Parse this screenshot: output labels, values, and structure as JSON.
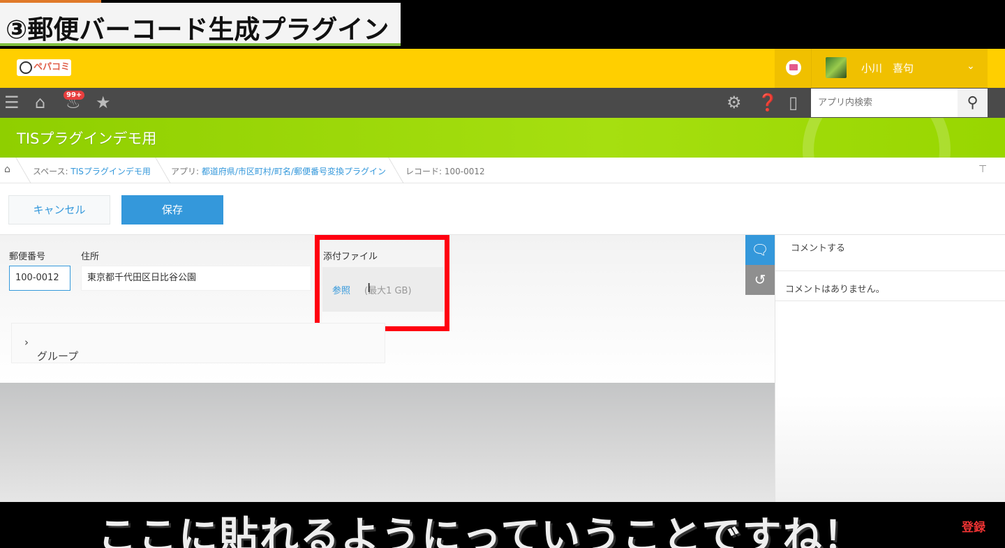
{
  "banner": {
    "title": "③郵便バーコード生成プラグイン"
  },
  "header": {
    "logo_text": "ペパコミ",
    "user_name": "小川　喜句"
  },
  "toolbar": {
    "notification_count": "99+",
    "search_placeholder": "アプリ内検索"
  },
  "app": {
    "title": "TISプラグインデモ用"
  },
  "breadcrumb": {
    "space_prefix": "スペース: ",
    "space_name": "TISプラグインデモ用",
    "app_prefix": "アプリ: ",
    "app_name": "都道府県/市区町村/町名/郵便番号変換プラグイン",
    "record": "レコード: 100-0012"
  },
  "actions": {
    "cancel_label": "キャンセル",
    "save_label": "保存"
  },
  "form": {
    "postal_label": "郵便番号",
    "postal_value": "100-0012",
    "address_label": "住所",
    "address_value": "東京都千代田区日比谷公園",
    "attachment_label": "添付ファイル",
    "browse_label": "参照",
    "max_size": "(最大1 GB)",
    "group_label": "グループ"
  },
  "comments": {
    "input_placeholder": "コメントする",
    "empty_text": "コメントはありません。"
  },
  "subtitle": {
    "text": "ここに貼れるようにっていうことですね！",
    "channel_mark": "登録"
  },
  "colors": {
    "header_yellow": "#ffcf00",
    "app_green": "#a6df10",
    "accent_blue": "#3498db",
    "highlight_red": "#ff0010"
  }
}
